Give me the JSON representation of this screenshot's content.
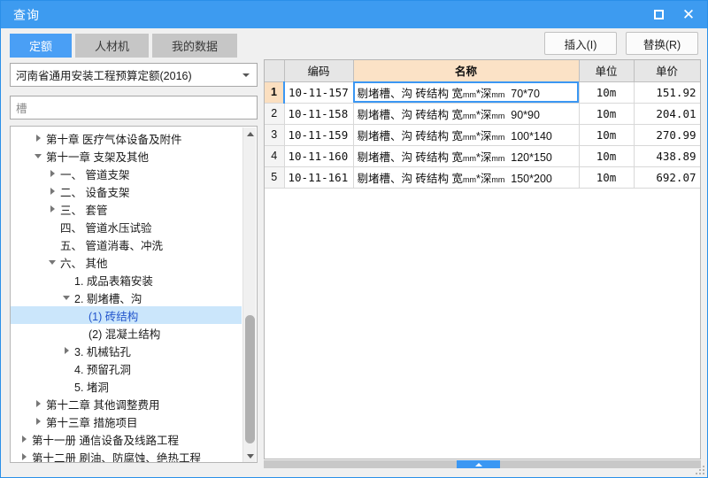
{
  "window": {
    "title": "查询",
    "maximize_icon": "maximize-icon",
    "close_icon": "close-icon"
  },
  "tabs": [
    {
      "label": "定额",
      "active": true
    },
    {
      "label": "人材机",
      "active": false
    },
    {
      "label": "我的数据",
      "active": false
    }
  ],
  "actions": {
    "insert_label": "插入(I)",
    "replace_label": "替换(R)"
  },
  "left": {
    "library_select": {
      "value": "河南省通用安装工程预算定额(2016)",
      "arrow_icon": "chevron-down-icon"
    },
    "search": {
      "value": "槽",
      "placeholder": "槽"
    },
    "tree": [
      {
        "label": "第十章 医疗气体设备及附件",
        "indent": 1,
        "state": "collapsed",
        "selected": false
      },
      {
        "label": "第十一章 支架及其他",
        "indent": 1,
        "state": "expanded",
        "selected": false
      },
      {
        "label": "一、 管道支架",
        "indent": 2,
        "state": "collapsed",
        "selected": false
      },
      {
        "label": "二、 设备支架",
        "indent": 2,
        "state": "collapsed",
        "selected": false
      },
      {
        "label": "三、 套管",
        "indent": 2,
        "state": "collapsed",
        "selected": false
      },
      {
        "label": "四、 管道水压试验",
        "indent": 2,
        "state": "leaf",
        "selected": false
      },
      {
        "label": "五、 管道消毒、冲洗",
        "indent": 2,
        "state": "leaf",
        "selected": false
      },
      {
        "label": "六、 其他",
        "indent": 2,
        "state": "expanded",
        "selected": false
      },
      {
        "label": "1. 成品表箱安装",
        "indent": 3,
        "state": "leaf",
        "selected": false
      },
      {
        "label": "2. 剔堵槽、沟",
        "indent": 3,
        "state": "expanded",
        "selected": false
      },
      {
        "label": "(1) 砖结构",
        "indent": 4,
        "state": "leaf",
        "selected": true
      },
      {
        "label": "(2) 混凝土结构",
        "indent": 4,
        "state": "leaf",
        "selected": false
      },
      {
        "label": "3. 机械钻孔",
        "indent": 3,
        "state": "collapsed",
        "selected": false
      },
      {
        "label": "4. 预留孔洞",
        "indent": 3,
        "state": "leaf",
        "selected": false
      },
      {
        "label": "5. 堵洞",
        "indent": 3,
        "state": "leaf",
        "selected": false
      },
      {
        "label": "第十二章 其他调整费用",
        "indent": 1,
        "state": "collapsed",
        "selected": false
      },
      {
        "label": "第十三章 措施项目",
        "indent": 1,
        "state": "collapsed",
        "selected": false
      },
      {
        "label": "第十一册 通信设备及线路工程",
        "indent": 0,
        "state": "collapsed",
        "selected": false
      },
      {
        "label": "第十二册 刷油、防腐蚀、绝热工程",
        "indent": 0,
        "state": "collapsed",
        "selected": false
      }
    ],
    "scrollbar": {
      "up_icon": "scroll-up-icon",
      "down_icon": "scroll-down-icon"
    }
  },
  "grid": {
    "columns": [
      "",
      "编码",
      "名称",
      "单位",
      "单价"
    ],
    "rows": [
      {
        "num": "1",
        "code": "10-11-157",
        "name_prefix": "剔堵槽、沟 砖结构 宽",
        "name_mid": "*深",
        "name_suffix": "70*70",
        "unit_sub": "mm",
        "unit": "10m",
        "price": "151.92",
        "selected": true
      },
      {
        "num": "2",
        "code": "10-11-158",
        "name_prefix": "剔堵槽、沟 砖结构 宽",
        "name_mid": "*深",
        "name_suffix": "90*90",
        "unit_sub": "mm",
        "unit": "10m",
        "price": "204.01",
        "selected": false
      },
      {
        "num": "3",
        "code": "10-11-159",
        "name_prefix": "剔堵槽、沟 砖结构 宽",
        "name_mid": "*深",
        "name_suffix": "100*140",
        "unit_sub": "mm",
        "unit": "10m",
        "price": "270.99",
        "selected": false
      },
      {
        "num": "4",
        "code": "10-11-160",
        "name_prefix": "剔堵槽、沟 砖结构 宽",
        "name_mid": "*深",
        "name_suffix": "120*150",
        "unit_sub": "mm",
        "unit": "10m",
        "price": "438.89",
        "selected": false
      },
      {
        "num": "5",
        "code": "10-11-161",
        "name_prefix": "剔堵槽、沟 砖结构 宽",
        "name_mid": "*深",
        "name_suffix": "150*200",
        "unit_sub": "mm",
        "unit": "10m",
        "price": "692.07",
        "selected": false
      }
    ]
  },
  "colors": {
    "accent": "#3d9bf0",
    "tab_active": "#4a9ff5",
    "name_header": "#fbe2c6",
    "selection": "#cbe6fb"
  }
}
